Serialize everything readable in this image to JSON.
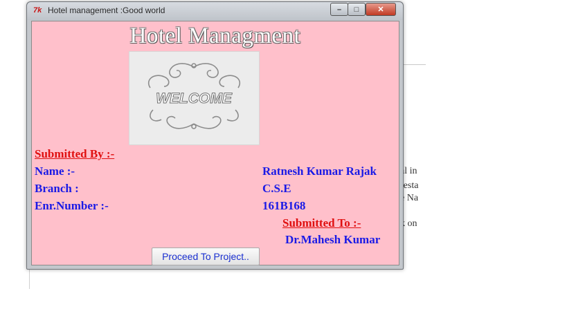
{
  "background": {
    "text_lines": [
      "al in",
      "resta",
      "e Na",
      "k on"
    ]
  },
  "window": {
    "app_icon": "7k",
    "title": "Hotel management :Good world",
    "controls": {
      "minimize": "–",
      "maximize": "□",
      "close": "✕"
    }
  },
  "app": {
    "heading": "Hotel Managment",
    "image": {
      "text": "WELCOME"
    },
    "submitted_by_label": "Submitted By :-",
    "name_label": "Name :-",
    "name_value": "Ratnesh Kumar Rajak",
    "branch_label": "Branch :",
    "branch_value": "C.S.E",
    "enr_label": "Enr.Number  :-",
    "enr_value": "161B168",
    "submitted_to_label": "Submitted To :-",
    "submitted_to_value": "Dr.Mahesh Kumar",
    "proceed_button": "Proceed To Project.."
  }
}
